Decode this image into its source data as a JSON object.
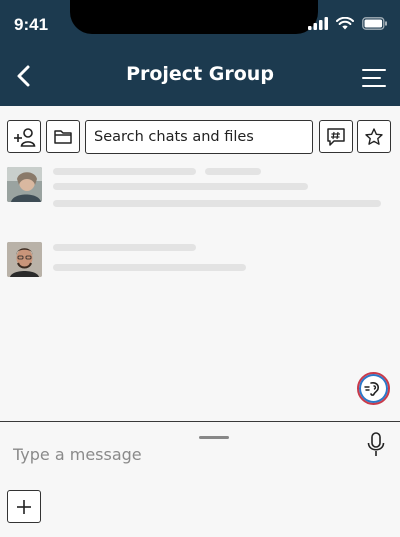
{
  "status_bar": {
    "time": "9:41",
    "icons": [
      "signal-icon",
      "wifi-icon",
      "battery-icon"
    ]
  },
  "header": {
    "title": "Project Group",
    "back_icon": "chevron-left-icon",
    "menu_icon": "menu-icon",
    "background": "#1c3a4f"
  },
  "toolbar": {
    "add_member_icon": "add-person-icon",
    "files_icon": "folder-icon",
    "search_placeholder": "Search chats and files",
    "hashtag_icon": "hashtag-chat-icon",
    "favorites_icon": "star-icon"
  },
  "chat_list": {
    "items": [
      {
        "avatar": "avatar-1",
        "loading": true
      },
      {
        "avatar": "avatar-2",
        "loading": true
      }
    ]
  },
  "voice_button": {
    "icon": "voice-assistant-icon"
  },
  "composer": {
    "placeholder": "Type a message",
    "mic_icon": "microphone-icon",
    "add_icon": "plus-icon"
  }
}
